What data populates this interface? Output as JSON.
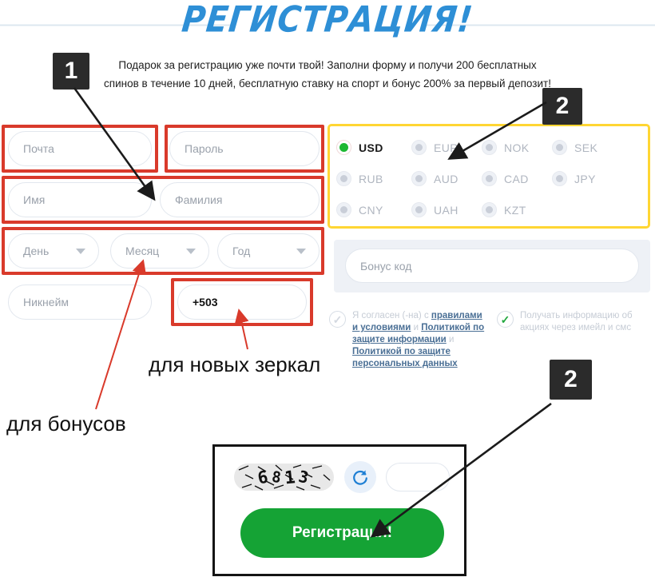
{
  "page": {
    "title": "РЕГИСТРАЦИЯ!",
    "intro": "Подарок за регистрацию уже почти твой! Заполни форму и получи 200 бесплатных спинов в течение 10 дней, бесплатную ставку на спорт и бонус 200% за первый депозит!"
  },
  "form": {
    "email_placeholder": "Почта",
    "password_placeholder": "Пароль",
    "firstname_placeholder": "Имя",
    "lastname_placeholder": "Фамилия",
    "day_placeholder": "День",
    "month_placeholder": "Месяц",
    "year_placeholder": "Год",
    "nickname_placeholder": "Никнейм",
    "phone_value": "+503"
  },
  "currency": {
    "selected": "USD",
    "options": [
      {
        "code": "USD",
        "checked": true
      },
      {
        "code": "EUR",
        "checked": false
      },
      {
        "code": "NOK",
        "checked": false
      },
      {
        "code": "SEK",
        "checked": false
      },
      {
        "code": "RUB",
        "checked": false
      },
      {
        "code": "AUD",
        "checked": false
      },
      {
        "code": "CAD",
        "checked": false
      },
      {
        "code": "JPY",
        "checked": false
      },
      {
        "code": "CNY",
        "checked": false
      },
      {
        "code": "UAH",
        "checked": false
      },
      {
        "code": "KZT",
        "checked": false
      }
    ]
  },
  "bonus": {
    "placeholder": "Бонус код"
  },
  "agreements": {
    "terms": {
      "checked": false,
      "prefix": "Я согласен (-на) с ",
      "link1": "правилами и условиями",
      "mid1": " и ",
      "link2": "Политикой по защите информации",
      "mid2": " и ",
      "link3": "Политикой по защите персональных данных"
    },
    "promo": {
      "checked": true,
      "text": "Получать информацию об акциях через имейл и смс"
    }
  },
  "captcha": {
    "code": "6813",
    "digits": [
      "6",
      "8",
      "1",
      "3"
    ],
    "refresh_icon": "refresh-icon",
    "input_value": ""
  },
  "submit": {
    "label": "Регистрация!"
  },
  "annotations": {
    "badge_1": "1",
    "badge_2": "2",
    "badge_3": "2",
    "note_bonuses": "для бонусов",
    "note_mirrors": "для новых зеркал"
  },
  "colors": {
    "title_blue": "#2e8fd6",
    "annotation_red": "#d93a2b",
    "currency_yellow": "#ffd633",
    "submit_green": "#15a335",
    "badge_dark": "#2b2b2b"
  }
}
